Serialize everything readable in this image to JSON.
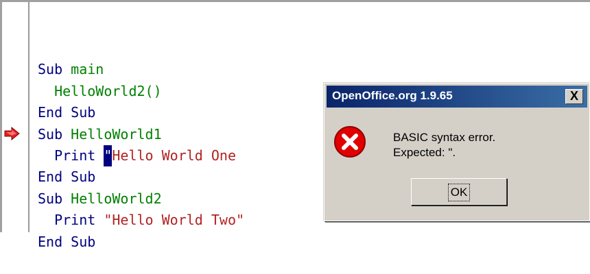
{
  "editor": {
    "lines": [
      {
        "kw": "Sub ",
        "id": "main",
        "str": ""
      },
      {
        "indent": "  ",
        "id": "HelloWorld2()"
      },
      {
        "kw": "End Sub"
      },
      {
        "kw": "Sub ",
        "id": "HelloWorld1"
      },
      {
        "indent": "  ",
        "kw": "Print ",
        "str": "\"Hello World One"
      },
      {
        "kw": "End Sub"
      },
      {
        "kw": "Sub ",
        "id": "HelloWorld2"
      },
      {
        "indent": "  ",
        "kw": "Print ",
        "str": "\"Hello World Two\""
      },
      {
        "kw": "End Sub"
      }
    ]
  },
  "dialog": {
    "title": "OpenOffice.org 1.9.65",
    "close_label": "X",
    "message_line1": "BASIC syntax error.",
    "message_line2": "Expected: \".",
    "ok_label": "OK"
  },
  "icons": {
    "breakpoint": "red-arrow-icon",
    "error": "error-x-icon"
  },
  "colors": {
    "keyword": "#000080",
    "identifier": "#008000",
    "string": "#b22222",
    "titlebar": "#0a246a",
    "error_icon": "#e00000"
  }
}
